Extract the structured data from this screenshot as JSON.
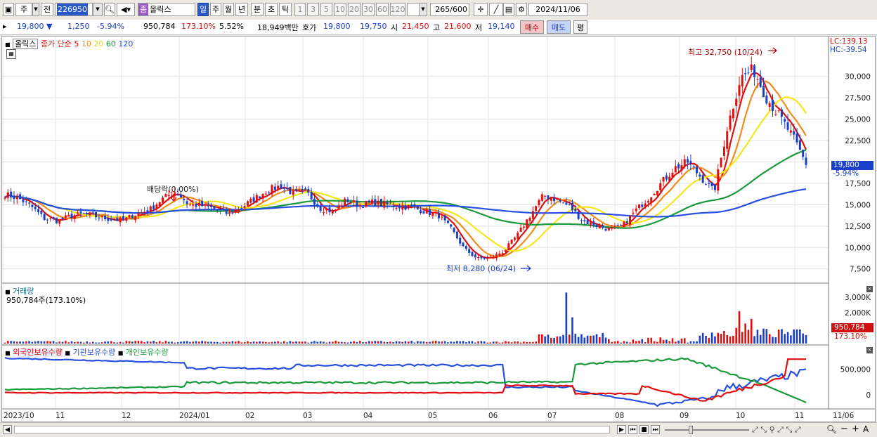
{
  "toolbar": {
    "period_label": "주",
    "prev_label": "전",
    "code": "226950",
    "name": "올릭스",
    "name_badge": "종",
    "periods": [
      "일",
      "주",
      "월",
      "년",
      "분",
      "초",
      "틱"
    ],
    "active_period": "일",
    "intervals": [
      "1",
      "3",
      "5",
      "10",
      "20",
      "30",
      "60",
      "120"
    ],
    "count": "265",
    "count_total": "/600",
    "date": "2024/11/06"
  },
  "quote": {
    "price": "19,800",
    "change": "1,250",
    "change_pct": "-5.94%",
    "volume": "950,784",
    "volume_ratio": "173.10%",
    "turnover": "5.52%",
    "amount": "18,949백만",
    "bid_label": "호가",
    "bid": "19,800",
    "ask": "19,750",
    "open_label": "시",
    "open": "21,450",
    "high_label": "고",
    "high": "21,600",
    "low_label": "저",
    "low": "19,140",
    "buy_button": "매수",
    "sell_button": "매도",
    "eval_button": "평"
  },
  "price_panel": {
    "name_tag": "올릭스",
    "legend_close": "종가 단순",
    "ma_periods": [
      "5",
      "10",
      "20",
      "60",
      "120"
    ],
    "ma_colors": [
      "#e01010",
      "#f08c1e",
      "#f5e61e",
      "#1a9a3c",
      "#2850e0"
    ],
    "lc": "LC:139.13",
    "hc": "HC:-39.54",
    "high_note": "최고 32,750 (10/24)",
    "low_note": "최저 8,280 (06/24)",
    "dividend_note": "배당락(0.00%)",
    "price_tag": "19,800",
    "pct_tag": "-5.94%",
    "y_ticks": [
      "30,000",
      "27,500",
      "25,000",
      "22,500",
      "17,500",
      "15,000",
      "12,500",
      "10,000",
      "7,500"
    ]
  },
  "volume_panel": {
    "title": "거래량",
    "summary": "950,784주(173.10%)",
    "y_ticks": [
      "3,000K",
      "2,000K",
      "1,000K"
    ],
    "tag_value": "950,784",
    "tag_pct": "173.10%"
  },
  "holding_panel": {
    "legend": [
      "외국인보유수량",
      "기관보유수량",
      "개인보유수량"
    ],
    "colors": [
      "#e01010",
      "#2850e0",
      "#1a9a3c"
    ],
    "y_ticks": [
      "500,000",
      "0"
    ]
  },
  "x_axis": [
    "2023/10",
    "11",
    "12",
    "2024/01",
    "02",
    "03",
    "04",
    "05",
    "06",
    "07",
    "08",
    "09",
    "10",
    "11",
    "11/06"
  ],
  "chart_data": {
    "type": "line",
    "ohlc_close_approx": [
      16200,
      15800,
      14800,
      13400,
      13100,
      13700,
      13900,
      13600,
      13300,
      13200,
      13900,
      14400,
      15700,
      16600,
      15000,
      14900,
      14500,
      13900,
      14700,
      15700,
      16700,
      17200,
      16300,
      16400,
      14600,
      14200,
      15600,
      14900,
      15300,
      15000,
      14800,
      14700,
      14200,
      13800,
      12100,
      9800,
      8700,
      8800,
      9600,
      11400,
      13800,
      16100,
      15600,
      14800,
      13100,
      12600,
      12100,
      12500,
      14300,
      15800,
      17600,
      19300,
      20000,
      18200,
      16500,
      24000,
      29800,
      30800,
      27500,
      25300,
      22900,
      19800
    ],
    "price_range": [
      7500,
      32750
    ],
    "volume_range_k": [
      0,
      3500
    ],
    "holding_range": [
      -250000,
      800000
    ],
    "annotations": [
      {
        "label": "최고 32,750 (10/24)",
        "value": 32750
      },
      {
        "label": "최저 8,280 (06/24)",
        "value": 8280
      }
    ]
  }
}
